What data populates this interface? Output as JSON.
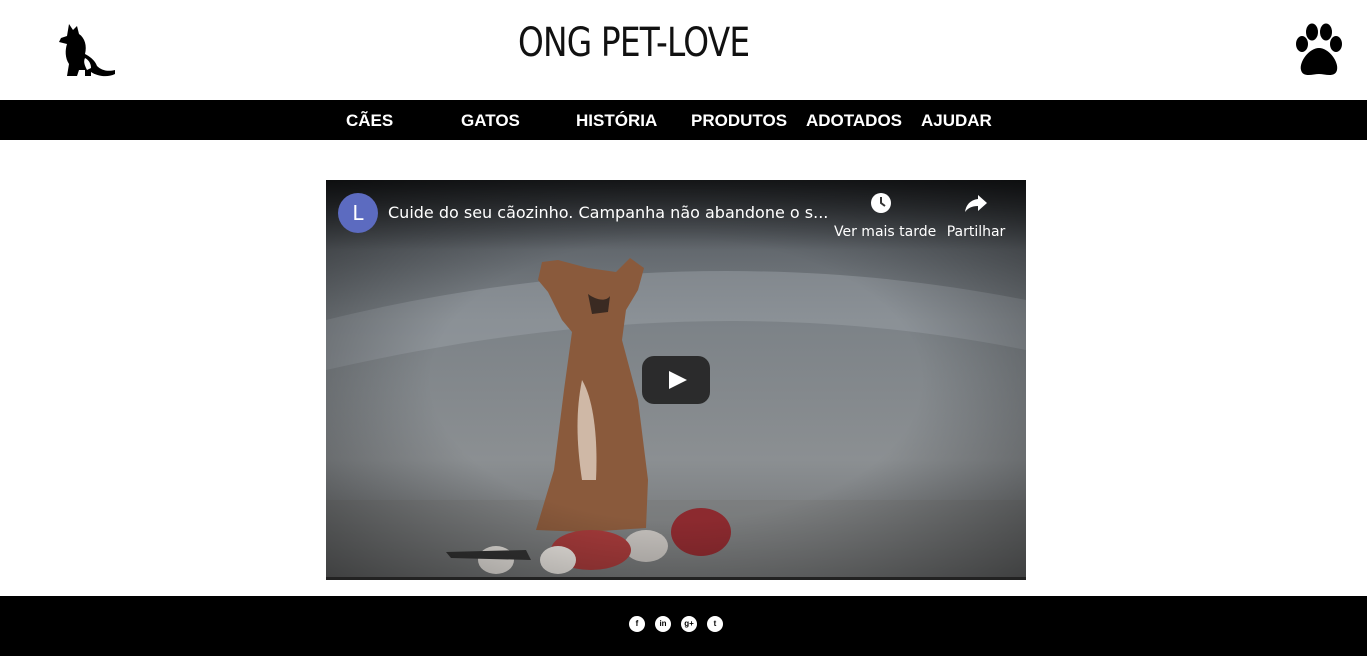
{
  "header": {
    "title": "ONG PET-LOVE",
    "logo_icon": "dog-cat-logo-icon",
    "paw_icon": "paw-icon"
  },
  "nav": {
    "items": [
      {
        "label": "CÃES"
      },
      {
        "label": "GATOS"
      },
      {
        "label": "HISTÓRIA"
      },
      {
        "label": "PRODUTOS"
      },
      {
        "label": "ADOTADOS"
      },
      {
        "label": "AJUDAR"
      }
    ]
  },
  "video": {
    "channel_initial": "L",
    "title": "Cuide do seu cãozinho. Campanha não abandone o s...",
    "watch_later_label": "Ver mais tarde",
    "share_label": "Partilhar",
    "avatar_color": "#5c6bc0"
  },
  "footer": {
    "social": [
      {
        "icon": "facebook-icon",
        "glyph": "f"
      },
      {
        "icon": "linkedin-icon",
        "glyph": "in"
      },
      {
        "icon": "google-plus-icon",
        "glyph": "g+"
      },
      {
        "icon": "twitter-icon",
        "glyph": "t"
      }
    ]
  }
}
